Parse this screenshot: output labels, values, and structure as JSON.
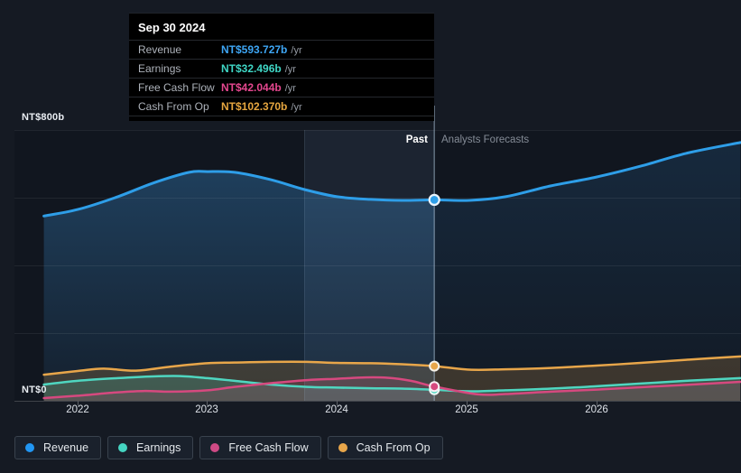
{
  "tooltip": {
    "date": "Sep 30 2024",
    "rows": [
      {
        "label": "Revenue",
        "value": "NT$593.727b",
        "suffix": "/yr",
        "color": "#3ea6f5"
      },
      {
        "label": "Earnings",
        "value": "NT$32.496b",
        "suffix": "/yr",
        "color": "#3fd6c5"
      },
      {
        "label": "Free Cash Flow",
        "value": "NT$42.044b",
        "suffix": "/yr",
        "color": "#e5478f"
      },
      {
        "label": "Cash From Op",
        "value": "NT$102.370b",
        "suffix": "/yr",
        "color": "#e6a63f"
      }
    ]
  },
  "axis": {
    "y_top": "NT$800b",
    "y_zero": "NT$0",
    "x_ticks": [
      "2022",
      "2023",
      "2024",
      "2025",
      "2026"
    ]
  },
  "sections": {
    "past": "Past",
    "forecast": "Analysts Forecasts"
  },
  "legend": [
    {
      "label": "Revenue",
      "color": "#2196f3"
    },
    {
      "label": "Earnings",
      "color": "#45d5c2"
    },
    {
      "label": "Free Cash Flow",
      "color": "#cf4a85"
    },
    {
      "label": "Cash From Op",
      "color": "#e8a64a"
    }
  ],
  "chart_data": {
    "type": "line",
    "ylabel": "NT$ billions",
    "ylim": [
      0,
      800
    ],
    "x_range": [
      2021.74,
      2027.11
    ],
    "divider_x": 2024.75,
    "ttm_band": [
      2023.75,
      2024.75
    ],
    "grid": true,
    "legend_position": "bottom",
    "series": [
      {
        "key": "revenue",
        "name": "Revenue",
        "color": "#2e9ee8",
        "x": [
          2021.74,
          2022.0,
          2022.31,
          2022.58,
          2022.86,
          2023.0,
          2023.21,
          2023.49,
          2023.75,
          2024.0,
          2024.26,
          2024.5,
          2024.75,
          2025.02,
          2025.3,
          2025.65,
          2026.0,
          2026.34,
          2026.69,
          2027.11
        ],
        "values": [
          546,
          565,
          603,
          643,
          675,
          677,
          675,
          653,
          624,
          603,
          595,
          592,
          593.727,
          592,
          603,
          635,
          661,
          693,
          731,
          763
        ]
      },
      {
        "key": "earnings",
        "name": "Earnings",
        "color": "#4fd6c0",
        "x": [
          2021.74,
          2022.0,
          2022.31,
          2022.58,
          2022.79,
          2023.0,
          2023.21,
          2023.49,
          2023.77,
          2024.0,
          2024.26,
          2024.5,
          2024.75,
          2025.02,
          2025.3,
          2025.65,
          2026.0,
          2026.34,
          2026.69,
          2027.11
        ],
        "values": [
          48,
          59,
          67,
          72,
          73,
          67,
          59,
          48,
          41,
          39,
          37,
          36,
          32.496,
          28,
          31,
          36,
          43,
          51,
          59,
          67
        ]
      },
      {
        "key": "fcf",
        "name": "Free Cash Flow",
        "color": "#d6497f",
        "x": [
          2021.74,
          2022.0,
          2022.31,
          2022.52,
          2022.72,
          2023.0,
          2023.21,
          2023.49,
          2023.77,
          2024.0,
          2024.22,
          2024.39,
          2024.57,
          2024.75,
          2025.09,
          2025.3,
          2025.65,
          2026.0,
          2026.34,
          2026.69,
          2027.11
        ],
        "values": [
          8,
          15,
          25,
          29,
          27,
          31,
          41,
          52,
          61,
          65,
          69,
          68,
          59,
          42.044,
          19,
          20,
          27,
          33,
          40,
          47,
          56
        ]
      },
      {
        "key": "cashop",
        "name": "Cash From Op",
        "color": "#e8a64a",
        "x": [
          2021.74,
          2022.0,
          2022.2,
          2022.45,
          2022.72,
          2023.0,
          2023.21,
          2023.49,
          2023.77,
          2024.0,
          2024.26,
          2024.5,
          2024.75,
          2025.02,
          2025.3,
          2025.65,
          2026.0,
          2026.34,
          2026.69,
          2027.11
        ],
        "values": [
          77,
          88,
          95,
          89,
          101,
          111,
          113,
          115,
          115,
          112,
          111,
          108,
          102.37,
          92,
          93,
          97,
          104,
          112,
          121,
          131
        ]
      }
    ],
    "markers": {
      "x": 2024.75,
      "values": {
        "revenue": 593.727,
        "earnings": 32.496,
        "fcf": 42.044,
        "cashop": 102.37
      }
    }
  }
}
